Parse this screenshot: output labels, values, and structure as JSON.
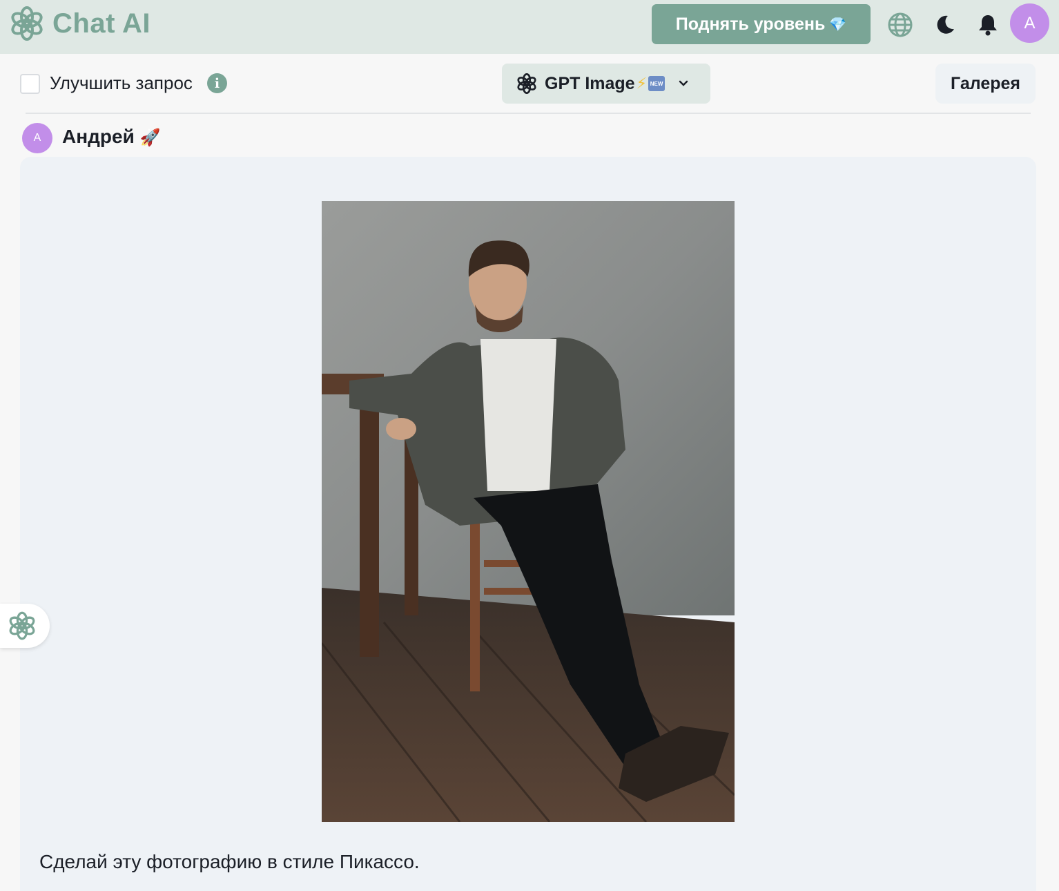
{
  "header": {
    "app_name": "Chat AI",
    "upgrade_label": "Поднять уровень",
    "upgrade_emoji": "💎",
    "user_initial": "A"
  },
  "toolbar": {
    "improve_label": "Улучшить запрос",
    "improve_checked": false,
    "info_glyph": "i",
    "model_name": "GPT Image",
    "model_bolt": "⚡",
    "model_new_badge": "NEW",
    "gallery_label": "Галерея"
  },
  "message": {
    "author_initial": "A",
    "author_name": "Андрей",
    "author_emoji": "🚀",
    "text": "Сделай эту фотографию в стиле Пикассо."
  },
  "icons": {
    "logo": "openai-knot-icon",
    "globe": "globe-icon",
    "theme": "moon-icon",
    "notifications": "bell-icon",
    "dropdown": "chevron-down-icon",
    "side": "openai-knot-icon"
  },
  "colors": {
    "accent": "#7aa596",
    "header_bg": "#dfe8e4",
    "avatar": "#c28ee9",
    "bubble_bg": "#eef2f6"
  }
}
